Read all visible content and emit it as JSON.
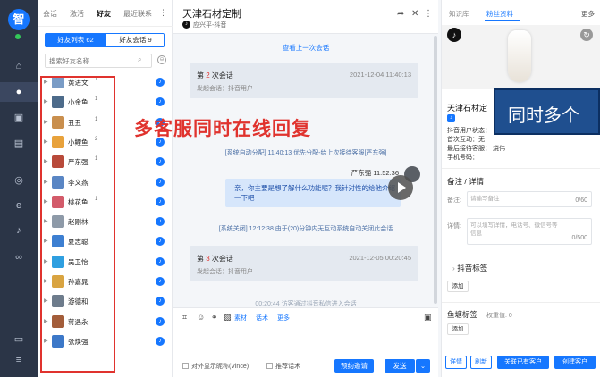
{
  "app": {
    "logo_text": "智"
  },
  "rail_icons": [
    "home-icon",
    "chat-icon",
    "contacts-icon",
    "document-icon",
    "wechat-icon",
    "browser-icon",
    "douyin-icon",
    "link-icon",
    "monitor-icon",
    "menu-icon"
  ],
  "friends_panel": {
    "tabs": [
      "会话",
      "激活",
      "好友",
      "最近联系"
    ],
    "active_tab": "好友",
    "segment": {
      "friend_list": "好友列表 62",
      "friend_sessions": "好友会话 9"
    },
    "search_placeholder": "搜索好友名称",
    "friends": [
      {
        "name": "黄进文",
        "count": "1",
        "avatar_color": "#7a9cc6"
      },
      {
        "name": "小金鱼",
        "count": "1",
        "avatar_color": "#4d6b8a"
      },
      {
        "name": "丑丑",
        "count": "1",
        "avatar_color": "#c98f4e"
      },
      {
        "name": "小鲤鱼",
        "count": "2",
        "avatar_color": "#e8a23c"
      },
      {
        "name": "严东强",
        "count": "1",
        "avatar_color": "#b84a3a"
      },
      {
        "name": "李义燕",
        "count": "",
        "avatar_color": "#5a86c4"
      },
      {
        "name": "桃花鱼",
        "count": "1",
        "avatar_color": "#d35b6a"
      },
      {
        "name": "赵刚林",
        "count": "",
        "avatar_color": "#8e9aa8"
      },
      {
        "name": "夏志聪",
        "count": "",
        "avatar_color": "#3d7fd1"
      },
      {
        "name": "吴卫怡",
        "count": "",
        "avatar_color": "#2f9fe0"
      },
      {
        "name": "孙嘉晁",
        "count": "",
        "avatar_color": "#d9a441"
      },
      {
        "name": "游德和",
        "count": "",
        "avatar_color": "#6e7c8c"
      },
      {
        "name": "蒋遇永",
        "count": "",
        "avatar_color": "#a35d3a"
      },
      {
        "name": "张焕强",
        "count": "",
        "avatar_color": "#3c78c8"
      }
    ]
  },
  "chat": {
    "title": "天津石材定制",
    "subtitle": "应兴平-抖音",
    "view_prev": "查看上一次会话",
    "sessions": [
      {
        "label_prefix": "第 ",
        "num": "2",
        "label_suffix": " 次会话",
        "time": "2021-12-04 11:40:13",
        "initiator": "发起会话：抖音用户"
      },
      {
        "label_prefix": "第 ",
        "num": "3",
        "label_suffix": " 次会话",
        "time": "2021-12-05 00:20:45",
        "initiator": "发起会话：抖音用户"
      }
    ],
    "system_assign": "[系统自动分配] 11:40:13 优先分配-给上次接待客服[严东强]",
    "agent_name": "严东强 11:52:36",
    "agent_message": "亲，你主要是想了解什么功能呢？我针对性的给他介绍一下吧",
    "system_close": "[系统关闭] 12:12:38 由于(20)分钟内无互动系统自动关闭此会话",
    "partial_line": "00:20:44 访客通过抖音私信进入会话",
    "toolbar": {
      "material": "素材",
      "phrase": "话术",
      "more": "更多"
    },
    "show_nickname": "对外显示昵称(Vince)",
    "recommend": "推荐话术",
    "invite_btn": "预约邀请",
    "send_btn": "发送"
  },
  "customer": {
    "tabs": [
      "知识库",
      "粉丝资料"
    ],
    "active_tab": "粉丝资料",
    "more": "更多",
    "name": "天津石材定",
    "info_lines": [
      "抖音用户状态：",
      "首次互动：无",
      "最后接待客服：  烧伟",
      "手机号码："
    ],
    "remark_section": "备注 / 详情",
    "remark_label": "备注:",
    "remark_placeholder": "请输写备注",
    "remark_count": "0/60",
    "detail_label": "详情:",
    "detail_placeholder": "可以填写详情，电话号、微信号等信息",
    "detail_count": "0/500",
    "tag_section": "抖音标签",
    "add": "添加",
    "fishpond_section": "鱼塘标签",
    "fishpond_count": "权重值: 0",
    "buttons": [
      "详情",
      "刷新",
      "关联已有客户",
      "创建客户"
    ]
  },
  "overlays": {
    "red_text": "多客服同时在线回复",
    "banner_text": "同时多个"
  }
}
